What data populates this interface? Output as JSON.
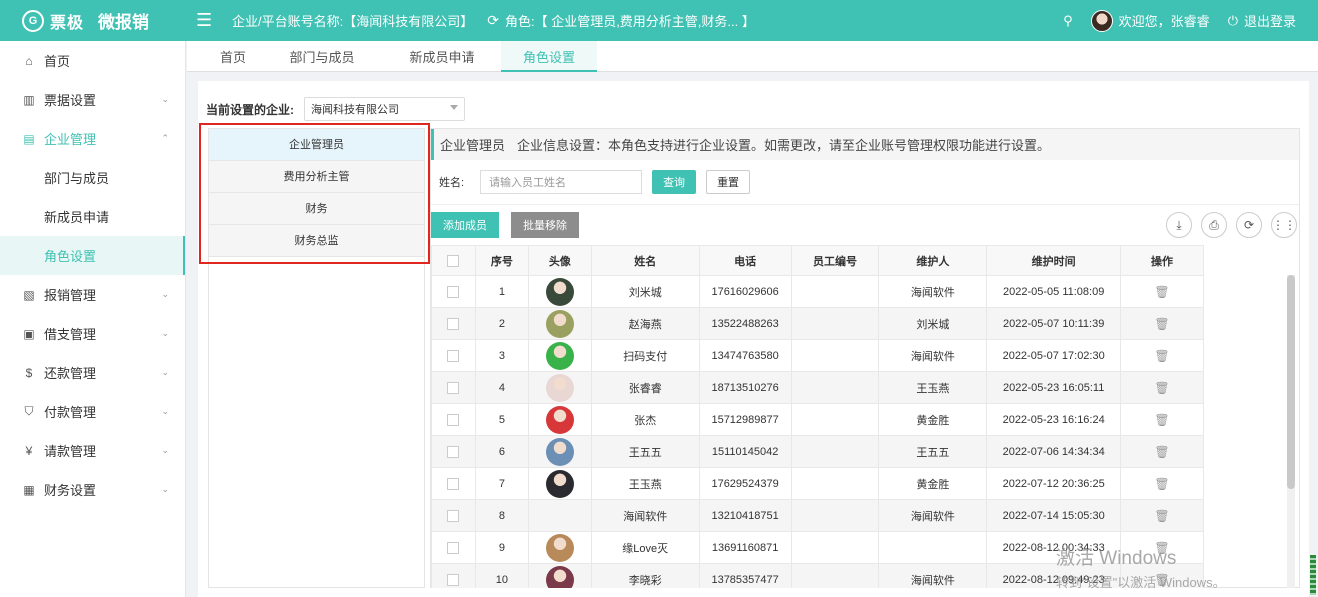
{
  "header": {
    "logo_text": "票极",
    "logo_mark": "G",
    "app_name": "微报销",
    "company_label": "企业/平台账号名称:【海闻科技有限公司】",
    "role_label": "角色:【 企业管理员,费用分析主管,财务... 】",
    "welcome": "欢迎您，张睿睿",
    "logout": "退出登录"
  },
  "sidebar": {
    "items": [
      {
        "label": "首页",
        "icon": "home-icon",
        "glyph": "⌂"
      },
      {
        "label": "票据设置",
        "icon": "bar-chart-icon",
        "glyph": "▥"
      },
      {
        "label": "企业管理",
        "icon": "building-icon",
        "glyph": "▤"
      },
      {
        "label": "部门与成员"
      },
      {
        "label": "新成员申请"
      },
      {
        "label": "角色设置"
      },
      {
        "label": "报销管理",
        "icon": "receipt-icon",
        "glyph": "▧"
      },
      {
        "label": "借支管理",
        "icon": "doc-icon",
        "glyph": "▣"
      },
      {
        "label": "还款管理",
        "icon": "dollar-icon",
        "glyph": "$"
      },
      {
        "label": "付款管理",
        "icon": "shield-icon",
        "glyph": "⛉"
      },
      {
        "label": "请款管理",
        "icon": "yen-icon",
        "glyph": "¥"
      },
      {
        "label": "财务设置",
        "icon": "grid-icon",
        "glyph": "▦"
      }
    ]
  },
  "tabs": [
    "首页",
    "部门与成员",
    "新成员申请",
    "角色设置"
  ],
  "enterprise": {
    "label": "当前设置的企业:",
    "value": "海闻科技有限公司"
  },
  "roles": [
    "企业管理员",
    "费用分析主管",
    "财务",
    "财务总监"
  ],
  "info_bar": {
    "role": "企业管理员",
    "desc": "企业信息设置：本角色支持进行企业设置。如需更改，请至企业账号管理权限功能进行设置。"
  },
  "search": {
    "label": "姓名:",
    "placeholder": "请输入员工姓名",
    "query_btn": "查询",
    "reset_btn": "重置"
  },
  "toolbar": {
    "add": "添加成员",
    "batch_remove": "批量移除"
  },
  "table": {
    "columns": [
      "序号",
      "头像",
      "姓名",
      "电话",
      "员工编号",
      "维护人",
      "维护时间",
      "操作"
    ],
    "rows": [
      {
        "no": "1",
        "name": "刘米城",
        "phone": "17616029606",
        "emp": "",
        "maintainer": "海闻软件",
        "time": "2022-05-05 11:08:09",
        "avatar": "#3a4a3a"
      },
      {
        "no": "2",
        "name": "赵海燕",
        "phone": "13522488263",
        "emp": "",
        "maintainer": "刘米城",
        "time": "2022-05-07 10:11:39",
        "avatar": "#9aa060"
      },
      {
        "no": "3",
        "name": "扫码支付",
        "phone": "13474763580",
        "emp": "",
        "maintainer": "海闻软件",
        "time": "2022-05-07 17:02:30",
        "avatar": "#39b24a"
      },
      {
        "no": "4",
        "name": "张睿睿",
        "phone": "18713510276",
        "emp": "",
        "maintainer": "王玉燕",
        "time": "2022-05-23 16:05:11",
        "avatar": "#e8d7d2"
      },
      {
        "no": "5",
        "name": "张杰",
        "phone": "15712989877",
        "emp": "",
        "maintainer": "黄金胜",
        "time": "2022-05-23 16:16:24",
        "avatar": "#d8373a"
      },
      {
        "no": "6",
        "name": "王五五",
        "phone": "15110145042",
        "emp": "",
        "maintainer": "王五五",
        "time": "2022-07-06 14:34:34",
        "avatar": "#6b8fb5"
      },
      {
        "no": "7",
        "name": "王玉燕",
        "phone": "17629524379",
        "emp": "",
        "maintainer": "黄金胜",
        "time": "2022-07-12 20:36:25",
        "avatar": "#2a2a30"
      },
      {
        "no": "8",
        "name": "海闻软件",
        "phone": "13210418751",
        "emp": "",
        "maintainer": "海闻软件",
        "time": "2022-07-14 15:05:30",
        "avatar": ""
      },
      {
        "no": "9",
        "name": "缘Love灭",
        "phone": "13691160871",
        "emp": "",
        "maintainer": "",
        "time": "2022-08-12 00:34:33",
        "avatar": "#b88a5a"
      },
      {
        "no": "10",
        "name": "李晓彩",
        "phone": "13785357477",
        "emp": "",
        "maintainer": "海闻软件",
        "time": "2022-08-12 09:49:23",
        "avatar": "#7a3a4a"
      }
    ]
  },
  "watermark": {
    "line1": "激活 Windows",
    "line2": "转到\"设置\"以激活 Windows。"
  },
  "colors": {
    "brand": "#3fc1b3",
    "highlight_border": "#e0261e"
  }
}
